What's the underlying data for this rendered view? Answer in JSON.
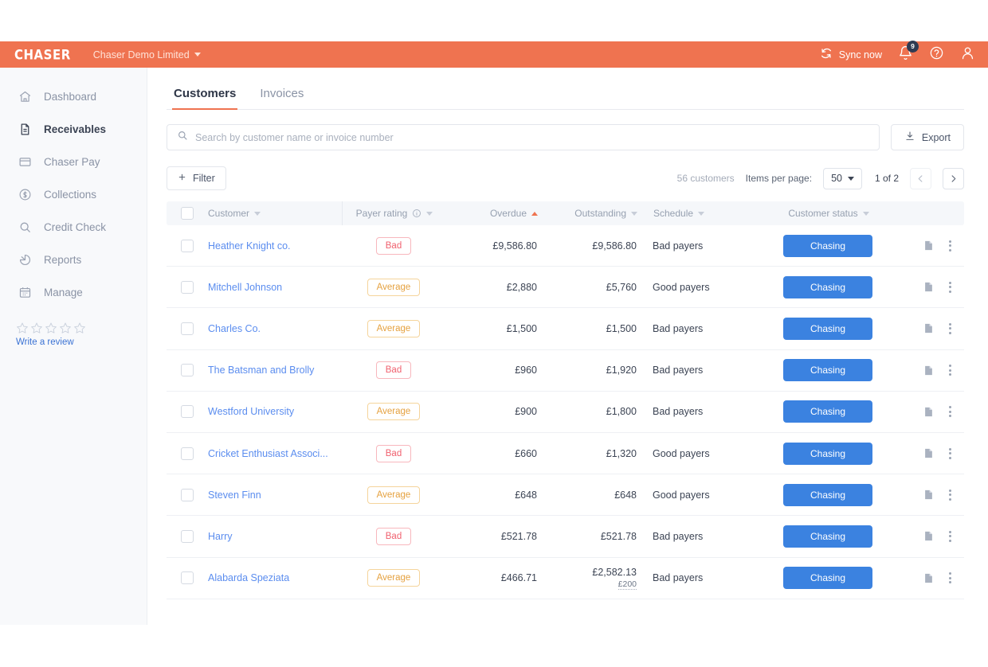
{
  "topbar": {
    "logo": "CHASER",
    "company": "Chaser Demo Limited",
    "sync_label": "Sync now",
    "notification_count": "9",
    "accent_color": "#ef7350"
  },
  "sidebar": {
    "items": [
      {
        "label": "Dashboard",
        "icon": "home-icon",
        "active": false
      },
      {
        "label": "Receivables",
        "icon": "document-icon",
        "active": true
      },
      {
        "label": "Chaser Pay",
        "icon": "card-icon",
        "active": false
      },
      {
        "label": "Collections",
        "icon": "dollar-circle-icon",
        "active": false
      },
      {
        "label": "Credit Check",
        "icon": "search-icon",
        "active": false
      },
      {
        "label": "Reports",
        "icon": "pie-chart-icon",
        "active": false
      },
      {
        "label": "Manage",
        "icon": "calendar-icon",
        "active": false
      }
    ],
    "review": {
      "stars": 5,
      "filled": 0,
      "link_label": "Write a review"
    }
  },
  "tabs": [
    {
      "label": "Customers",
      "active": true
    },
    {
      "label": "Invoices",
      "active": false
    }
  ],
  "search": {
    "placeholder": "Search by customer name or invoice number",
    "value": ""
  },
  "toolbar": {
    "export_label": "Export",
    "filter_label": "Filter",
    "count_label": "56 customers",
    "items_per_page_label": "Items per page:",
    "items_per_page_value": "50",
    "page_label": "1 of 2"
  },
  "table": {
    "columns": [
      {
        "label": "Customer",
        "sort": "none"
      },
      {
        "label": "Payer rating",
        "sort": "none",
        "info": true
      },
      {
        "label": "Overdue",
        "sort": "asc"
      },
      {
        "label": "Outstanding",
        "sort": "none"
      },
      {
        "label": "Schedule",
        "sort": "none"
      },
      {
        "label": "Customer status",
        "sort": "none"
      }
    ],
    "rows": [
      {
        "customer": "Heather Knight co.",
        "rating": "Bad",
        "overdue": "£9,586.80",
        "outstanding": "£9,586.80",
        "outstanding_sub": "",
        "schedule": "Bad payers",
        "status": "Chasing"
      },
      {
        "customer": "Mitchell Johnson",
        "rating": "Average",
        "overdue": "£2,880",
        "outstanding": "£5,760",
        "outstanding_sub": "",
        "schedule": "Good payers",
        "status": "Chasing"
      },
      {
        "customer": "Charles Co.",
        "rating": "Average",
        "overdue": "£1,500",
        "outstanding": "£1,500",
        "outstanding_sub": "",
        "schedule": "Bad payers",
        "status": "Chasing"
      },
      {
        "customer": "The Batsman and Brolly",
        "rating": "Bad",
        "overdue": "£960",
        "outstanding": "£1,920",
        "outstanding_sub": "",
        "schedule": "Bad payers",
        "status": "Chasing"
      },
      {
        "customer": "Westford University",
        "rating": "Average",
        "overdue": "£900",
        "outstanding": "£1,800",
        "outstanding_sub": "",
        "schedule": "Bad payers",
        "status": "Chasing"
      },
      {
        "customer": "Cricket Enthusiast Associ...",
        "rating": "Bad",
        "overdue": "£660",
        "outstanding": "£1,320",
        "outstanding_sub": "",
        "schedule": "Good payers",
        "status": "Chasing"
      },
      {
        "customer": "Steven Finn",
        "rating": "Average",
        "overdue": "£648",
        "outstanding": "£648",
        "outstanding_sub": "",
        "schedule": "Good payers",
        "status": "Chasing"
      },
      {
        "customer": "Harry",
        "rating": "Bad",
        "overdue": "£521.78",
        "outstanding": "£521.78",
        "outstanding_sub": "",
        "schedule": "Bad payers",
        "status": "Chasing"
      },
      {
        "customer": "Alabarda Speziata",
        "rating": "Average",
        "overdue": "£466.71",
        "outstanding": "£2,582.13",
        "outstanding_sub": "£200",
        "schedule": "Bad payers",
        "status": "Chasing"
      }
    ]
  },
  "colors": {
    "brand": "#ef7350",
    "link": "#5b8def",
    "primary_button": "#3b82e0",
    "badge_bad": "#f0616f",
    "badge_average": "#e5a13f"
  }
}
